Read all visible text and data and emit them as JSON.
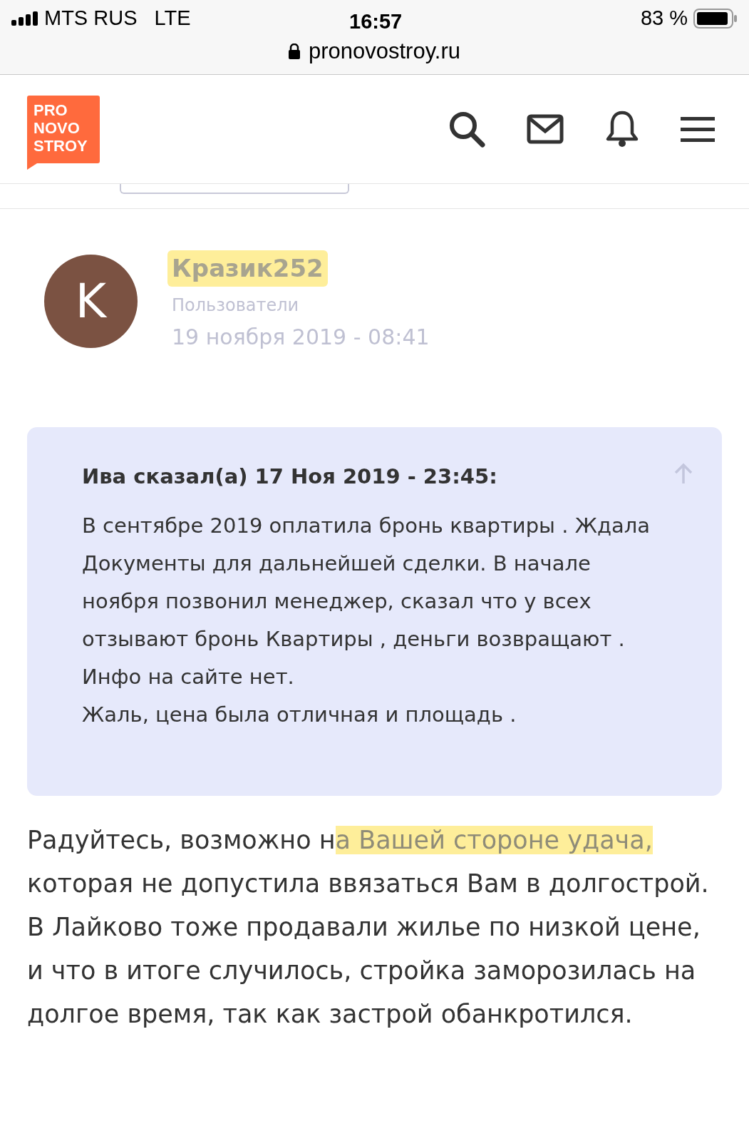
{
  "status_bar": {
    "carrier": "MTS RUS",
    "network": "LTE",
    "time": "16:57",
    "battery": "83 %"
  },
  "address_bar": {
    "url": "pronovostroy.ru"
  },
  "header": {
    "logo_lines": [
      "PRO",
      "NOVO",
      "STROY"
    ]
  },
  "post": {
    "avatar_letter": "K",
    "author": "Кразик252",
    "author_highlighted": true,
    "group": "Пользователи",
    "date": "19 ноября 2019 - 08:41",
    "quote": {
      "title": "Ива сказал(а) 17 Ноя 2019 - 23:45:",
      "paragraphs": [
        "В сентябре 2019 оплатила бронь квартиры . Ждала Документы для дальнейшей сделки. В начале ноября позвонил менеджер, сказал что у всех отзывают бронь Квартиры , деньги возвращают . Инфо на сайте нет.",
        "Жаль, цена была отличная и площадь ."
      ]
    },
    "body": [
      {
        "text": "Радуйтесь, возможно н",
        "highlighted": false
      },
      {
        "text": "а Вашей стороне удача,",
        "highlighted": true
      },
      {
        "text": " которая не допустила ввязаться Вам в долгострой. В Лайково тоже продавали жилье по низкой цене, и что в итоге случилось, стройка заморозилась на долгое время, так как застрой обанкротился.",
        "highlighted": false
      }
    ]
  }
}
